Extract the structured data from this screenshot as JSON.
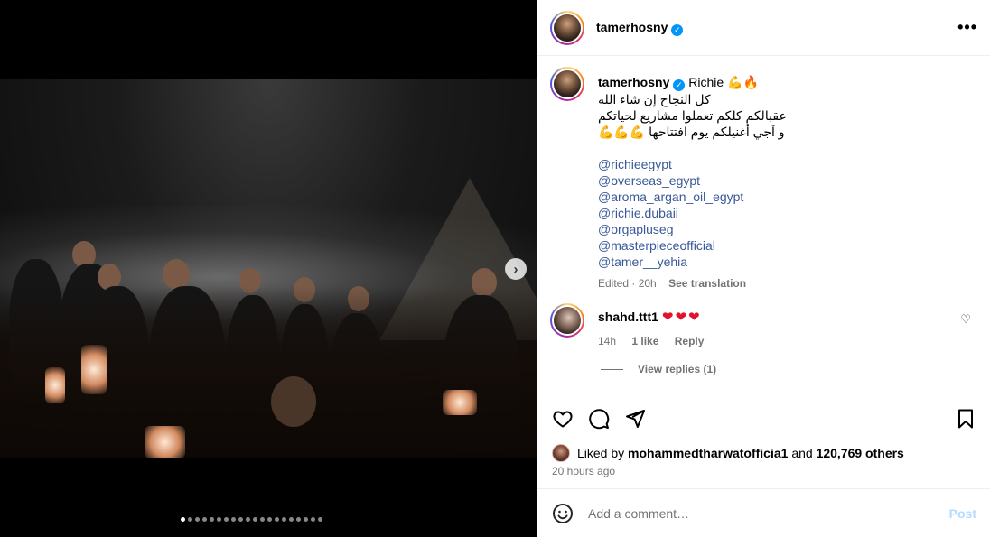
{
  "media": {
    "next_label": "›",
    "slide_count": 20,
    "active_slide": 1
  },
  "header": {
    "username": "tamerhosny",
    "verified": "✓",
    "more": "•••"
  },
  "caption": {
    "username": "tamerhosny",
    "verified": "✓",
    "first_text": "Richie 💪🔥",
    "line1": "كل النجاح إن شاء الله",
    "line2": "عقبالكم كلكم تعملوا مشاريع لحياتكم",
    "line3": "و آجي أغنيلكم يوم افتتاحها 💪💪💪",
    "mentions": [
      "@richieegypt",
      "@overseas_egypt",
      "@aroma_argan_oil_egypt",
      "@richie.dubaii",
      "@orgapluseg",
      "@masterpieceofficial",
      "@tamer__yehia"
    ],
    "edited": "Edited · 20h",
    "see_translation": "See translation"
  },
  "comment": {
    "username": "shahd.ttt1",
    "text": "❤❤❤",
    "time": "14h",
    "likes": "1 like",
    "reply": "Reply",
    "heart": "♡",
    "view_replies": "View replies (1)"
  },
  "actions": {
    "liked_prefix": "Liked by ",
    "liked_user": "mohammedtharwatofficia1",
    "liked_and": " and ",
    "liked_others": "120,769 others",
    "time": "20 hours ago"
  },
  "add_comment": {
    "placeholder": "Add a comment…",
    "post": "Post"
  }
}
